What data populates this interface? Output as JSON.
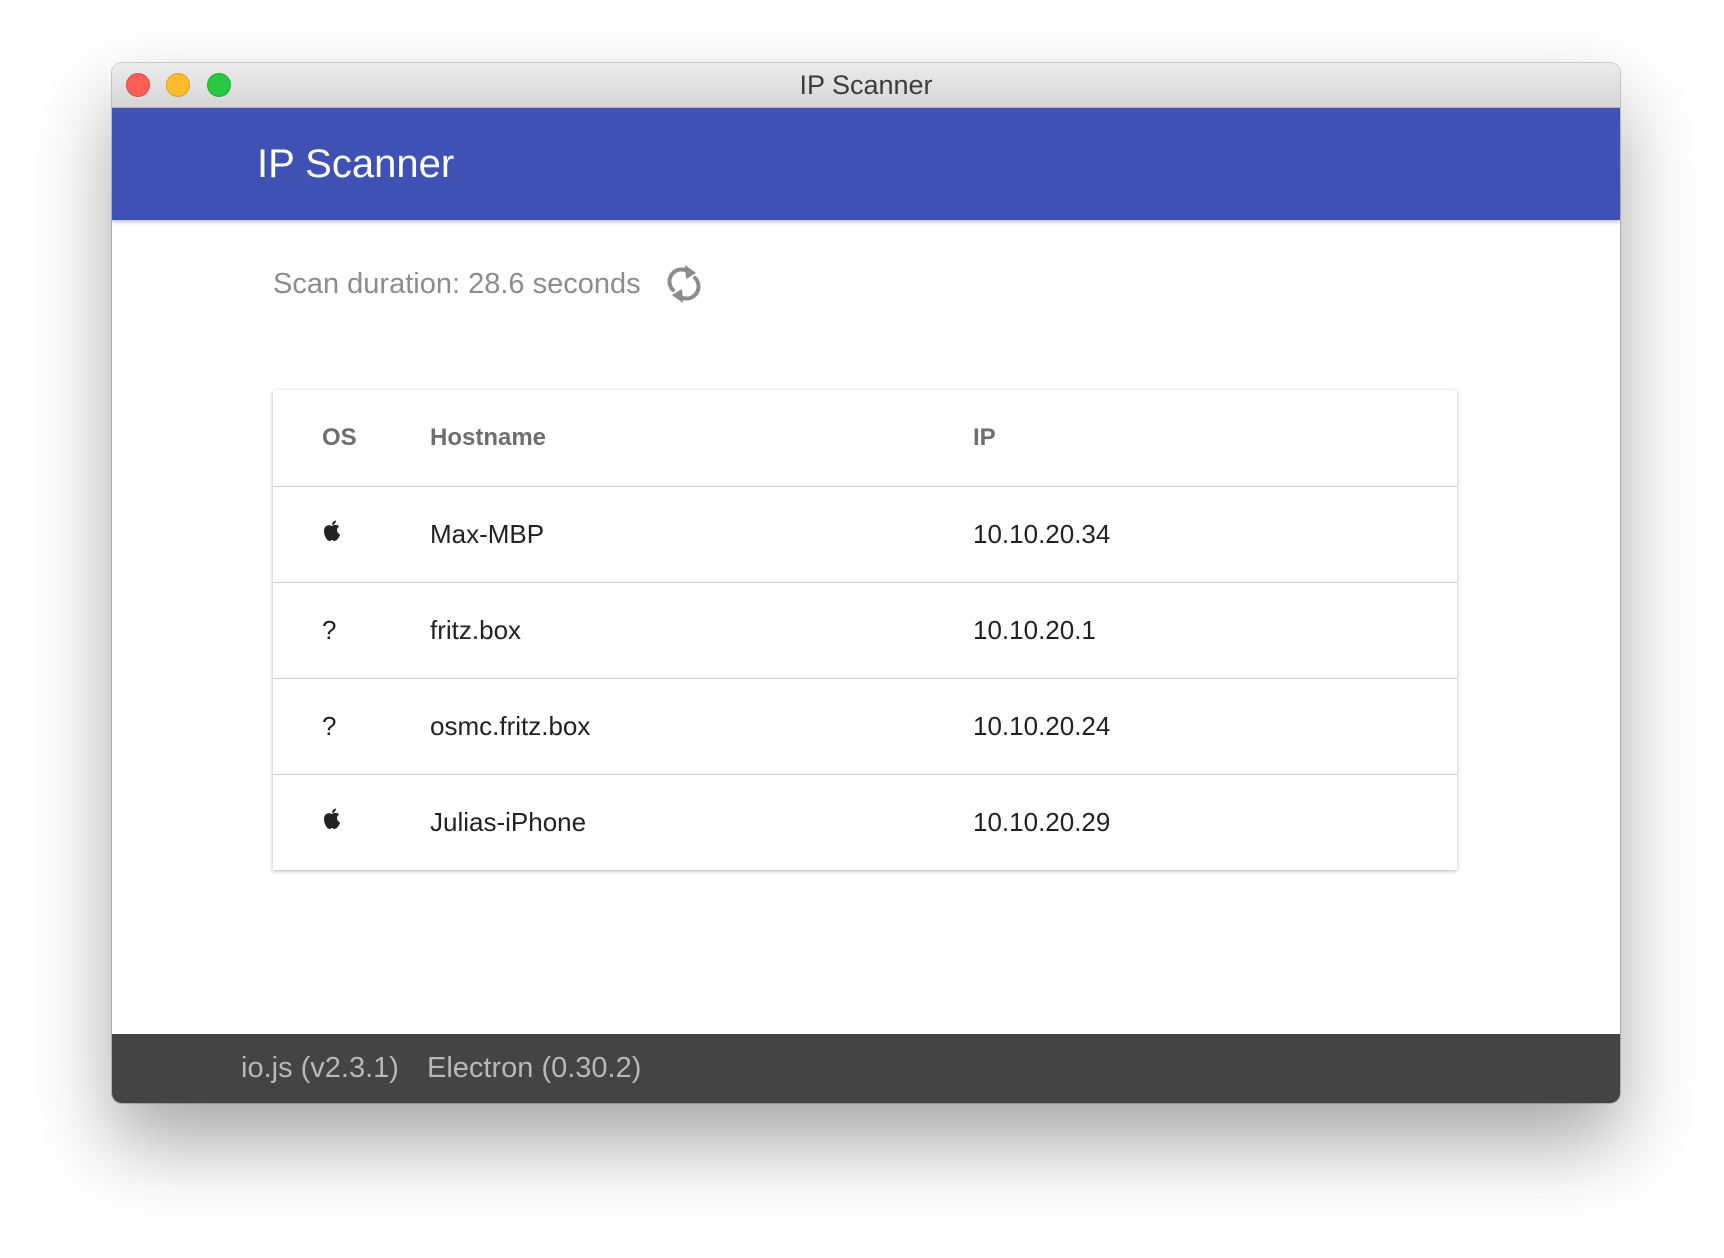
{
  "window": {
    "title": "IP Scanner"
  },
  "header": {
    "title": "IP Scanner",
    "color": "#3f51b5"
  },
  "scan": {
    "duration_text": "Scan duration: 28.6 seconds",
    "refresh_icon": "refresh-icon"
  },
  "table": {
    "columns": {
      "os": "OS",
      "hostname": "Hostname",
      "ip": "IP"
    },
    "rows": [
      {
        "os": "apple",
        "os_text": "",
        "hostname": "Max-MBP",
        "ip": "10.10.20.34"
      },
      {
        "os": "unknown",
        "os_text": "?",
        "hostname": "fritz.box",
        "ip": "10.10.20.1"
      },
      {
        "os": "unknown",
        "os_text": "?",
        "hostname": "osmc.fritz.box",
        "ip": "10.10.20.24"
      },
      {
        "os": "apple",
        "os_text": "",
        "hostname": "Julias-iPhone",
        "ip": "10.10.20.29"
      }
    ]
  },
  "footer": {
    "iojs": "io.js (v2.3.1)",
    "electron": "Electron (0.30.2)"
  }
}
